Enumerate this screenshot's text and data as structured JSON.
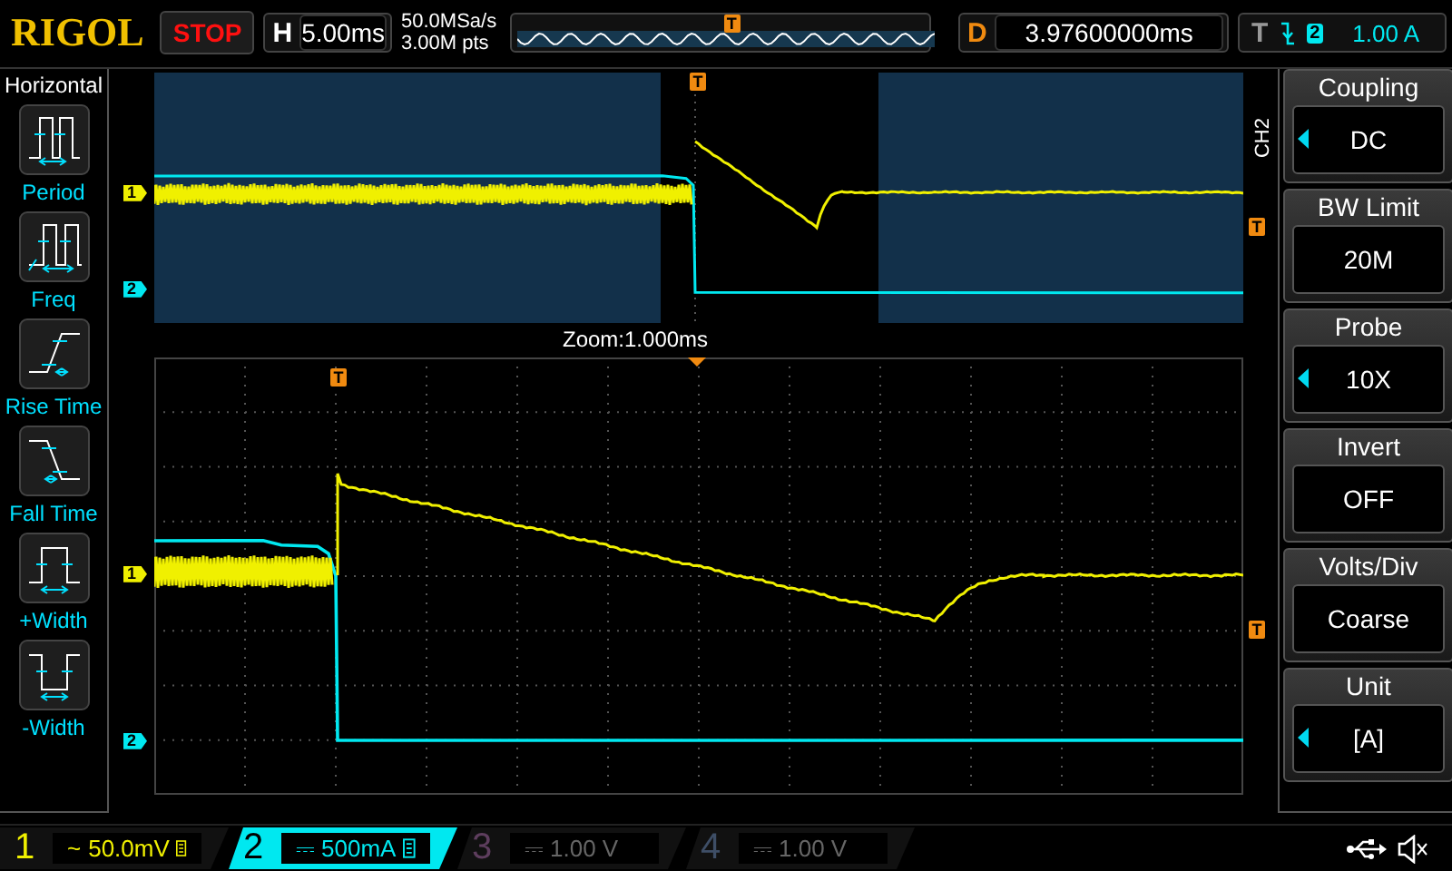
{
  "header": {
    "logo": "RIGOL",
    "run_state": "STOP",
    "timebase": {
      "label": "H",
      "value": "5.00ms"
    },
    "sampling": {
      "rate": "50.0MSa/s",
      "depth": "3.00M pts"
    },
    "timeline_marker": "T",
    "delay": {
      "label": "D",
      "value": "3.97600000ms"
    },
    "trigger": {
      "label": "T",
      "source": "2",
      "level": "1.00 A"
    }
  },
  "left_menu": {
    "title": "Horizontal",
    "items": [
      {
        "kind": "period",
        "label": "Period"
      },
      {
        "kind": "freq",
        "label": "Freq"
      },
      {
        "kind": "rise",
        "label": "Rise Time"
      },
      {
        "kind": "fall",
        "label": "Fall Time"
      },
      {
        "kind": "pwidth",
        "label": "+Width"
      },
      {
        "kind": "nwidth",
        "label": "-Width"
      }
    ]
  },
  "overview": {
    "trigger_marker": "T",
    "channel_markers": [
      "1",
      "2"
    ],
    "side_marker": "T"
  },
  "zoom_label": "Zoom:1.000ms",
  "main": {
    "trigger_marker": "T",
    "channel_markers": [
      "1",
      "2"
    ],
    "side_marker": "T"
  },
  "right_menu": {
    "channel": "CH2",
    "items": [
      {
        "title": "Coupling",
        "value": "DC",
        "adjustable": true
      },
      {
        "title": "BW Limit",
        "value": "20M",
        "adjustable": false
      },
      {
        "title": "Probe",
        "value": "10X",
        "adjustable": true
      },
      {
        "title": "Invert",
        "value": "OFF",
        "adjustable": false
      },
      {
        "title": "Volts/Div",
        "value": "Coarse",
        "adjustable": false
      },
      {
        "title": "Unit",
        "value": "[A]",
        "adjustable": true
      }
    ]
  },
  "channels": [
    {
      "number": "1",
      "coupling": "~",
      "scale": "50.0mV",
      "bw_limit": true,
      "enabled": true,
      "selected": false,
      "color": "#f0f000"
    },
    {
      "number": "2",
      "coupling": "⎓",
      "scale": "500mA",
      "bw_limit": true,
      "enabled": true,
      "selected": true,
      "color": "#00e8f0"
    },
    {
      "number": "3",
      "coupling": "⎓",
      "scale": "1.00 V",
      "bw_limit": false,
      "enabled": false,
      "selected": false,
      "color": "#5e3e5e"
    },
    {
      "number": "4",
      "coupling": "⎓",
      "scale": "1.00 V",
      "bw_limit": false,
      "enabled": false,
      "selected": false,
      "color": "#3e4e66"
    }
  ]
}
